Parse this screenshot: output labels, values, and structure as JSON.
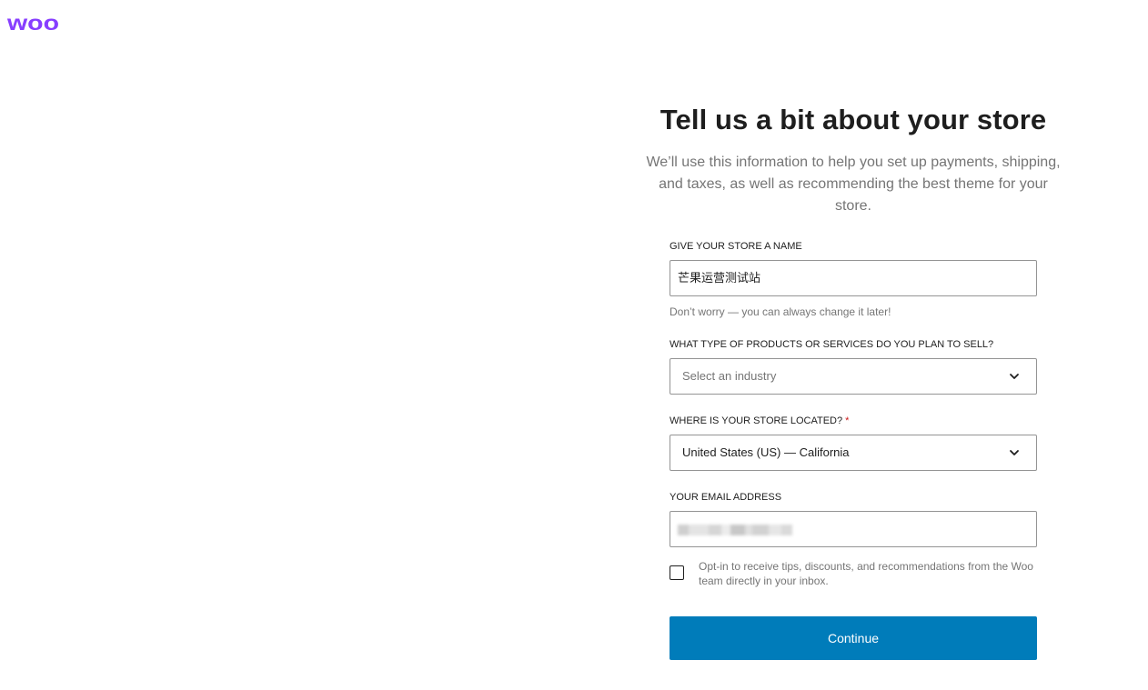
{
  "brand": {
    "logo_text": "woo",
    "color": "#873eff"
  },
  "intro": {
    "heading": "Tell us a bit about your store",
    "subheading": "We’ll use this information to help you set up payments, shipping, and taxes, as well as recommending the best theme for your store."
  },
  "form": {
    "store_name": {
      "label": "GIVE YOUR STORE A NAME",
      "value": "芒果运营测试站",
      "help": "Don’t worry — you can always change it later!"
    },
    "industry": {
      "label": "WHAT TYPE OF PRODUCTS OR SERVICES DO YOU PLAN TO SELL?",
      "placeholder": "Select an industry",
      "icon": "chevron-down-icon"
    },
    "location": {
      "label": "WHERE IS YOUR STORE LOCATED?",
      "required_mark": "*",
      "value": "United States (US) — California",
      "icon": "chevron-down-icon"
    },
    "email": {
      "label": "YOUR EMAIL ADDRESS",
      "value_redacted": true
    },
    "opt_in": {
      "checked": false,
      "label": "Opt-in to receive tips, discounts, and recommendations from the Woo team directly in your inbox."
    },
    "continue_label": "Continue"
  },
  "colors": {
    "primary_button": "#007cba",
    "text": "#1e1e1e",
    "muted_text": "#757575",
    "border": "#949494",
    "required": "#cc1818"
  }
}
